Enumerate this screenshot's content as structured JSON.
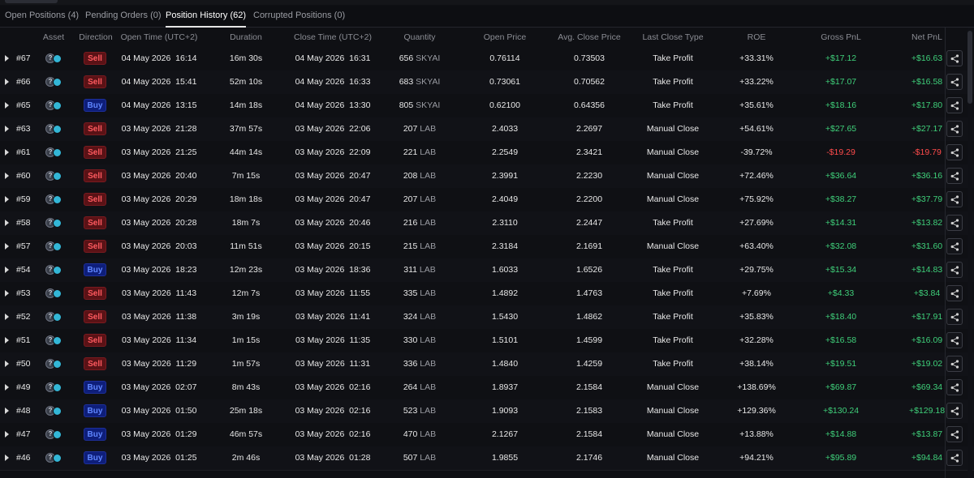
{
  "tabs": [
    {
      "label": "Open Positions (4)",
      "active": false
    },
    {
      "label": "Pending Orders (0)",
      "active": false
    },
    {
      "label": "Position History (62)",
      "active": true
    },
    {
      "label": "Corrupted Positions (0)",
      "active": false
    }
  ],
  "headers": {
    "asset": "Asset",
    "direction": "Direction",
    "open_time": "Open Time (UTC+2)",
    "duration": "Duration",
    "close_time": "Close Time (UTC+2)",
    "quantity": "Quantity",
    "open_price": "Open Price",
    "avg_close_price": "Avg. Close Price",
    "last_close_type": "Last Close Type",
    "roe": "ROE",
    "gross_pnl": "Gross PnL",
    "net_pnl": "Net PnL"
  },
  "icons": {
    "expand": "caret-right-icon",
    "share": "share-icon",
    "asset": "coin-pair-icon"
  },
  "colors": {
    "sell": "#ff5a5f",
    "buy": "#5f86ff",
    "profit": "#3fd07a",
    "loss": "#ff4b4b"
  },
  "rows": [
    {
      "id": "#67",
      "direction": "Sell",
      "open_date": "04 May 2026",
      "open_time": "16:14",
      "duration": "16m 30s",
      "close_date": "04 May 2026",
      "close_time": "16:31",
      "qty": "656",
      "symbol": "SKYAI",
      "open_price": "0.76114",
      "close_price": "0.73503",
      "close_type": "Take Profit",
      "roe": "+33.31%",
      "gross": "+$17.12",
      "net": "+$16.63",
      "gross_sign": "pos",
      "net_sign": "pos"
    },
    {
      "id": "#66",
      "direction": "Sell",
      "open_date": "04 May 2026",
      "open_time": "15:41",
      "duration": "52m 10s",
      "close_date": "04 May 2026",
      "close_time": "16:33",
      "qty": "683",
      "symbol": "SKYAI",
      "open_price": "0.73061",
      "close_price": "0.70562",
      "close_type": "Take Profit",
      "roe": "+33.22%",
      "gross": "+$17.07",
      "net": "+$16.58",
      "gross_sign": "pos",
      "net_sign": "pos"
    },
    {
      "id": "#65",
      "direction": "Buy",
      "open_date": "04 May 2026",
      "open_time": "13:15",
      "duration": "14m 18s",
      "close_date": "04 May 2026",
      "close_time": "13:30",
      "qty": "805",
      "symbol": "SKYAI",
      "open_price": "0.62100",
      "close_price": "0.64356",
      "close_type": "Take Profit",
      "roe": "+35.61%",
      "gross": "+$18.16",
      "net": "+$17.80",
      "gross_sign": "pos",
      "net_sign": "pos"
    },
    {
      "id": "#63",
      "direction": "Sell",
      "open_date": "03 May 2026",
      "open_time": "21:28",
      "duration": "37m 57s",
      "close_date": "03 May 2026",
      "close_time": "22:06",
      "qty": "207",
      "symbol": "LAB",
      "open_price": "2.4033",
      "close_price": "2.2697",
      "close_type": "Manual Close",
      "roe": "+54.61%",
      "gross": "+$27.65",
      "net": "+$27.17",
      "gross_sign": "pos",
      "net_sign": "pos"
    },
    {
      "id": "#61",
      "direction": "Sell",
      "open_date": "03 May 2026",
      "open_time": "21:25",
      "duration": "44m 14s",
      "close_date": "03 May 2026",
      "close_time": "22:09",
      "qty": "221",
      "symbol": "LAB",
      "open_price": "2.2549",
      "close_price": "2.3421",
      "close_type": "Manual Close",
      "roe": "-39.72%",
      "gross": "-$19.29",
      "net": "-$19.79",
      "gross_sign": "neg",
      "net_sign": "neg"
    },
    {
      "id": "#60",
      "direction": "Sell",
      "open_date": "03 May 2026",
      "open_time": "20:40",
      "duration": "7m 15s",
      "close_date": "03 May 2026",
      "close_time": "20:47",
      "qty": "208",
      "symbol": "LAB",
      "open_price": "2.3991",
      "close_price": "2.2230",
      "close_type": "Manual Close",
      "roe": "+72.46%",
      "gross": "+$36.64",
      "net": "+$36.16",
      "gross_sign": "pos",
      "net_sign": "pos"
    },
    {
      "id": "#59",
      "direction": "Sell",
      "open_date": "03 May 2026",
      "open_time": "20:29",
      "duration": "18m 18s",
      "close_date": "03 May 2026",
      "close_time": "20:47",
      "qty": "207",
      "symbol": "LAB",
      "open_price": "2.4049",
      "close_price": "2.2200",
      "close_type": "Manual Close",
      "roe": "+75.92%",
      "gross": "+$38.27",
      "net": "+$37.79",
      "gross_sign": "pos",
      "net_sign": "pos"
    },
    {
      "id": "#58",
      "direction": "Sell",
      "open_date": "03 May 2026",
      "open_time": "20:28",
      "duration": "18m 7s",
      "close_date": "03 May 2026",
      "close_time": "20:46",
      "qty": "216",
      "symbol": "LAB",
      "open_price": "2.3110",
      "close_price": "2.2447",
      "close_type": "Take Profit",
      "roe": "+27.69%",
      "gross": "+$14.31",
      "net": "+$13.82",
      "gross_sign": "pos",
      "net_sign": "pos"
    },
    {
      "id": "#57",
      "direction": "Sell",
      "open_date": "03 May 2026",
      "open_time": "20:03",
      "duration": "11m 51s",
      "close_date": "03 May 2026",
      "close_time": "20:15",
      "qty": "215",
      "symbol": "LAB",
      "open_price": "2.3184",
      "close_price": "2.1691",
      "close_type": "Manual Close",
      "roe": "+63.40%",
      "gross": "+$32.08",
      "net": "+$31.60",
      "gross_sign": "pos",
      "net_sign": "pos"
    },
    {
      "id": "#54",
      "direction": "Buy",
      "open_date": "03 May 2026",
      "open_time": "18:23",
      "duration": "12m 23s",
      "close_date": "03 May 2026",
      "close_time": "18:36",
      "qty": "311",
      "symbol": "LAB",
      "open_price": "1.6033",
      "close_price": "1.6526",
      "close_type": "Take Profit",
      "roe": "+29.75%",
      "gross": "+$15.34",
      "net": "+$14.83",
      "gross_sign": "pos",
      "net_sign": "pos"
    },
    {
      "id": "#53",
      "direction": "Sell",
      "open_date": "03 May 2026",
      "open_time": "11:43",
      "duration": "12m 7s",
      "close_date": "03 May 2026",
      "close_time": "11:55",
      "qty": "335",
      "symbol": "LAB",
      "open_price": "1.4892",
      "close_price": "1.4763",
      "close_type": "Take Profit",
      "roe": "+7.69%",
      "gross": "+$4.33",
      "net": "+$3.84",
      "gross_sign": "pos",
      "net_sign": "pos"
    },
    {
      "id": "#52",
      "direction": "Sell",
      "open_date": "03 May 2026",
      "open_time": "11:38",
      "duration": "3m 19s",
      "close_date": "03 May 2026",
      "close_time": "11:41",
      "qty": "324",
      "symbol": "LAB",
      "open_price": "1.5430",
      "close_price": "1.4862",
      "close_type": "Take Profit",
      "roe": "+35.83%",
      "gross": "+$18.40",
      "net": "+$17.91",
      "gross_sign": "pos",
      "net_sign": "pos"
    },
    {
      "id": "#51",
      "direction": "Sell",
      "open_date": "03 May 2026",
      "open_time": "11:34",
      "duration": "1m 15s",
      "close_date": "03 May 2026",
      "close_time": "11:35",
      "qty": "330",
      "symbol": "LAB",
      "open_price": "1.5101",
      "close_price": "1.4599",
      "close_type": "Take Profit",
      "roe": "+32.28%",
      "gross": "+$16.58",
      "net": "+$16.09",
      "gross_sign": "pos",
      "net_sign": "pos"
    },
    {
      "id": "#50",
      "direction": "Sell",
      "open_date": "03 May 2026",
      "open_time": "11:29",
      "duration": "1m 57s",
      "close_date": "03 May 2026",
      "close_time": "11:31",
      "qty": "336",
      "symbol": "LAB",
      "open_price": "1.4840",
      "close_price": "1.4259",
      "close_type": "Take Profit",
      "roe": "+38.14%",
      "gross": "+$19.51",
      "net": "+$19.02",
      "gross_sign": "pos",
      "net_sign": "pos"
    },
    {
      "id": "#49",
      "direction": "Buy",
      "open_date": "03 May 2026",
      "open_time": "02:07",
      "duration": "8m 43s",
      "close_date": "03 May 2026",
      "close_time": "02:16",
      "qty": "264",
      "symbol": "LAB",
      "open_price": "1.8937",
      "close_price": "2.1584",
      "close_type": "Manual Close",
      "roe": "+138.69%",
      "gross": "+$69.87",
      "net": "+$69.34",
      "gross_sign": "pos",
      "net_sign": "pos"
    },
    {
      "id": "#48",
      "direction": "Buy",
      "open_date": "03 May 2026",
      "open_time": "01:50",
      "duration": "25m 18s",
      "close_date": "03 May 2026",
      "close_time": "02:16",
      "qty": "523",
      "symbol": "LAB",
      "open_price": "1.9093",
      "close_price": "2.1583",
      "close_type": "Manual Close",
      "roe": "+129.36%",
      "gross": "+$130.24",
      "net": "+$129.18",
      "gross_sign": "pos",
      "net_sign": "pos"
    },
    {
      "id": "#47",
      "direction": "Buy",
      "open_date": "03 May 2026",
      "open_time": "01:29",
      "duration": "46m 57s",
      "close_date": "03 May 2026",
      "close_time": "02:16",
      "qty": "470",
      "symbol": "LAB",
      "open_price": "2.1267",
      "close_price": "2.1584",
      "close_type": "Manual Close",
      "roe": "+13.88%",
      "gross": "+$14.88",
      "net": "+$13.87",
      "gross_sign": "pos",
      "net_sign": "pos"
    },
    {
      "id": "#46",
      "direction": "Buy",
      "open_date": "03 May 2026",
      "open_time": "01:25",
      "duration": "2m 46s",
      "close_date": "03 May 2026",
      "close_time": "01:28",
      "qty": "507",
      "symbol": "LAB",
      "open_price": "1.9855",
      "close_price": "2.1746",
      "close_type": "Manual Close",
      "roe": "+94.21%",
      "gross": "+$95.89",
      "net": "+$94.84",
      "gross_sign": "pos",
      "net_sign": "pos"
    }
  ]
}
